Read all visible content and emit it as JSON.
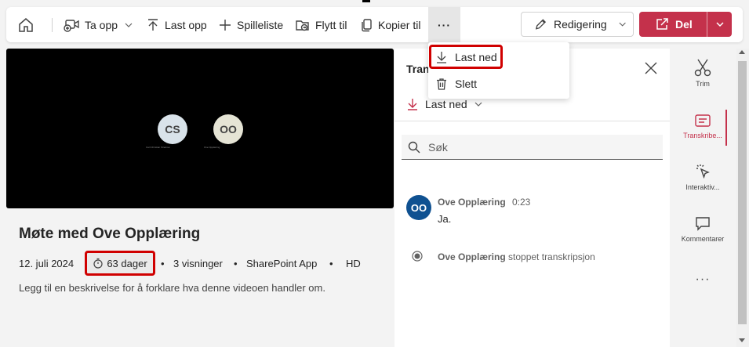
{
  "toolbar": {
    "record_label": "Ta opp",
    "upload_label": "Last opp",
    "playlist_label": "Spilleliste",
    "move_label": "Flytt til",
    "copy_label": "Kopier til",
    "more_label": "···",
    "edit_label": "Redigering",
    "share_label": "Del"
  },
  "more_menu": {
    "items": [
      {
        "label": "Last ned",
        "icon": "download-icon"
      },
      {
        "label": "Slett",
        "icon": "trash-icon"
      }
    ]
  },
  "video": {
    "participants": [
      {
        "initials": "CS",
        "caption": "Carl Christian Strømsø"
      },
      {
        "initials": "OO",
        "caption": "Ove Opplæring"
      }
    ]
  },
  "details": {
    "title": "Møte med Ove Opplæring",
    "date": "12. juli 2024",
    "age": "63 dager",
    "views": "3 visninger",
    "source": "SharePoint App",
    "quality": "HD",
    "separator": "•",
    "description": "Legg til en beskrivelse for å forklare hva denne videoen handler om."
  },
  "transcript": {
    "title_partial": "Tran",
    "download_label": "Last ned",
    "search_placeholder": "Søk",
    "entry": {
      "initials": "OO",
      "speaker": "Ove Opplæring",
      "time": "0:23",
      "text": "Ja."
    },
    "stop_event": {
      "speaker": "Ove Opplæring",
      "text": "stoppet transkripsjon"
    }
  },
  "rail": {
    "items": [
      {
        "label": "Trim",
        "icon": "scissors-icon"
      },
      {
        "label": "Transkribe...",
        "icon": "transcript-icon"
      },
      {
        "label": "Interaktiv...",
        "icon": "interactive-icon"
      },
      {
        "label": "Kommentarer",
        "icon": "comment-icon"
      }
    ],
    "more_label": "···"
  },
  "colors": {
    "accent": "#c4314b",
    "highlight": "#d00000",
    "avatar_blue": "#0f5191"
  }
}
